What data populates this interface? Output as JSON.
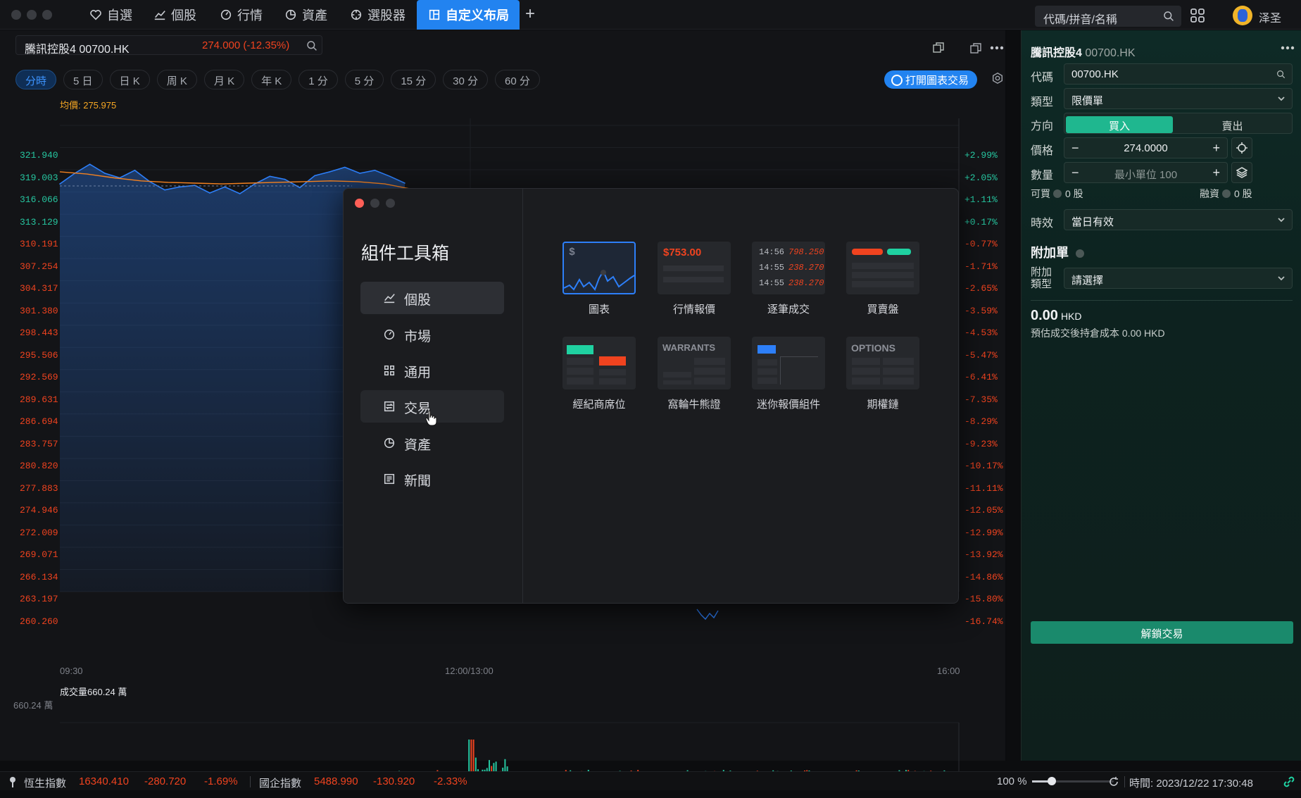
{
  "nav": {
    "tabs": [
      {
        "label": "自選",
        "icon": "heart-icon"
      },
      {
        "label": "個股",
        "icon": "line-chart-icon"
      },
      {
        "label": "行情",
        "icon": "gauge-icon"
      },
      {
        "label": "資產",
        "icon": "pie-icon"
      },
      {
        "label": "選股器",
        "icon": "target-icon"
      },
      {
        "label": "自定义布局",
        "icon": "layout-icon",
        "active": true
      }
    ],
    "add": "+",
    "search_placeholder": "代碼/拼音/名稱",
    "username": "泽圣"
  },
  "chart": {
    "stock_name": "騰訊控股4 00700.HK",
    "price_change": "274.000 (-12.35%)",
    "periods": [
      "分時",
      "5 日",
      "日 K",
      "周 K",
      "月 K",
      "年 K",
      "1 分",
      "5 分",
      "15 分",
      "30 分",
      "60 分"
    ],
    "open_chart_trade": "打開圖表交易",
    "avg_price": "均價: 275.975",
    "y_left": [
      "321.940",
      "319.003",
      "316.066",
      "313.129",
      "310.191",
      "307.254",
      "304.317",
      "301.380",
      "298.443",
      "295.506",
      "292.569",
      "289.631",
      "286.694",
      "283.757",
      "280.820",
      "277.883",
      "274.946",
      "272.009",
      "269.071",
      "266.134",
      "263.197",
      "260.260"
    ],
    "y_right": [
      "+2.99%",
      "+2.05%",
      "+1.11%",
      "+0.17%",
      "-0.77%",
      "-1.71%",
      "-2.65%",
      "-3.59%",
      "-4.53%",
      "-5.47%",
      "-6.41%",
      "-7.35%",
      "-8.29%",
      "-9.23%",
      "-10.17%",
      "-11.11%",
      "-12.05%",
      "-12.99%",
      "-13.92%",
      "-14.86%",
      "-15.80%",
      "-16.74%"
    ],
    "x_labels": [
      "09:30",
      "12:00/13:00",
      "16:00"
    ],
    "volume_title": "成交量660.24 萬",
    "volume_max": "660.24 萬",
    "colors": {
      "up": "#26c6a0",
      "down": "#f0431f",
      "line": "#2d7ff9",
      "avg": "#f5821f"
    }
  },
  "chart_data": {
    "type": "line",
    "title": "",
    "x_range": [
      "09:30",
      "16:00"
    ],
    "ylim": [
      260.26,
      321.94
    ],
    "series": [
      {
        "name": "均價",
        "values": [
          315.8,
          315.5,
          315.0,
          314.6,
          314.4,
          314.3,
          314.2,
          314.3,
          314.4,
          314.5,
          314.6,
          314.5,
          314.2,
          313.5
        ]
      },
      {
        "name": "",
        "values": [
          314.2,
          315.6,
          316.8,
          315.6,
          315.0,
          316.0,
          314.5,
          313.4,
          313.8,
          314.0,
          313.0,
          313.8,
          312.9,
          314.2,
          315.2,
          314.8,
          313.7,
          315.3,
          315.8,
          316.4,
          315.6,
          316.0,
          315.2,
          314.3
        ]
      }
    ]
  },
  "modal": {
    "title": "組件工具箱",
    "categories": [
      "個股",
      "市場",
      "通用",
      "交易",
      "資產",
      "新聞"
    ],
    "widgets": [
      {
        "label": "圖表",
        "thumb": "$"
      },
      {
        "label": "行情報價",
        "thumb": "$753.00"
      },
      {
        "label": "逐筆成交",
        "rows": [
          [
            "14:56",
            "798.250"
          ],
          [
            "14:55",
            "238.270"
          ],
          [
            "14:55",
            "238.270"
          ]
        ]
      },
      {
        "label": "買賣盤"
      },
      {
        "label": "經紀商席位"
      },
      {
        "label": "窩輪牛熊證",
        "thumb": "WARRANTS"
      },
      {
        "label": "迷你報價組件"
      },
      {
        "label": "期權鏈",
        "thumb": "OPTIONS"
      }
    ]
  },
  "trade": {
    "title": "騰訊控股4",
    "code_suffix": "00700.HK",
    "labels": {
      "code": "代碼",
      "type": "類型",
      "side": "方向",
      "price": "價格",
      "qty": "數量",
      "validity": "時效",
      "attach": "附加\n類型"
    },
    "code": "00700.HK",
    "order_type": "限價單",
    "buy": "買入",
    "sell": "賣出",
    "price": "274.0000",
    "qty_placeholder": "最小單位 100",
    "can_buy_label": "可買",
    "can_buy": "0 股",
    "margin_label": "融資",
    "margin": "0 股",
    "validity": "當日有效",
    "attach_title": "附加單",
    "attach_placeholder": "請選擇",
    "total": "0.00",
    "currency": "HKD",
    "estimate": "預估成交後持倉成本 0.00 HKD",
    "unlock": "解鎖交易"
  },
  "status": {
    "hsi_name": "恆生指數",
    "hsi_value": "16340.410",
    "hsi_change": "-280.720",
    "hsi_pct": "-1.69%",
    "hscei_name": "國企指數",
    "hscei_value": "5488.990",
    "hscei_change": "-130.920",
    "hscei_pct": "-2.33%",
    "zoom": "100 %",
    "time": "時間: 2023/12/22 17:30:48"
  }
}
